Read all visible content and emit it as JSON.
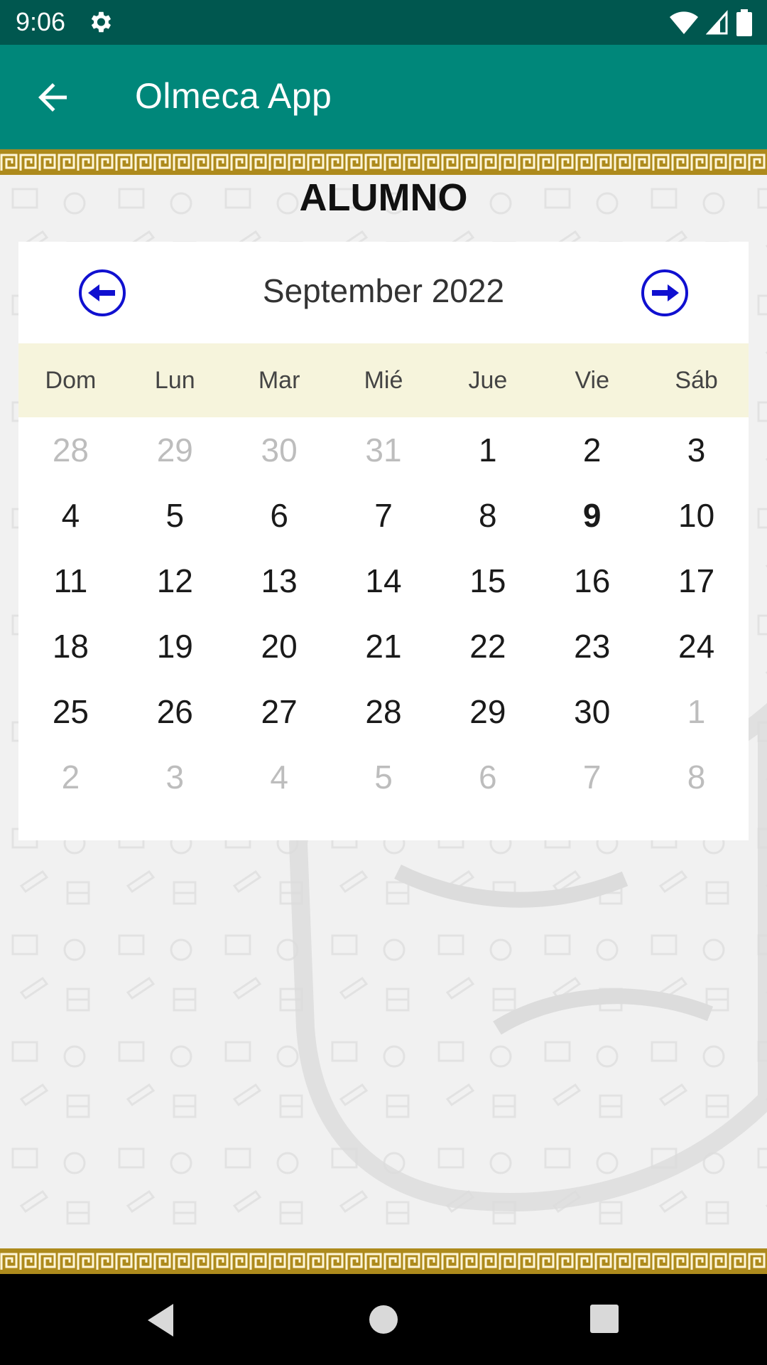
{
  "status_bar": {
    "time": "9:06"
  },
  "app_bar": {
    "title": "Olmeca App"
  },
  "page": {
    "title": "ALUMNO"
  },
  "calendar": {
    "month": "September 2022",
    "weekdays": [
      "Dom",
      "Lun",
      "Mar",
      "Mié",
      "Jue",
      "Vie",
      "Sáb"
    ],
    "days": [
      {
        "label": "28",
        "muted": true
      },
      {
        "label": "29",
        "muted": true
      },
      {
        "label": "30",
        "muted": true
      },
      {
        "label": "31",
        "muted": true
      },
      {
        "label": "1"
      },
      {
        "label": "2"
      },
      {
        "label": "3"
      },
      {
        "label": "4"
      },
      {
        "label": "5"
      },
      {
        "label": "6"
      },
      {
        "label": "7"
      },
      {
        "label": "8"
      },
      {
        "label": "9",
        "today": true
      },
      {
        "label": "10"
      },
      {
        "label": "11"
      },
      {
        "label": "12"
      },
      {
        "label": "13"
      },
      {
        "label": "14"
      },
      {
        "label": "15"
      },
      {
        "label": "16"
      },
      {
        "label": "17"
      },
      {
        "label": "18"
      },
      {
        "label": "19"
      },
      {
        "label": "20"
      },
      {
        "label": "21"
      },
      {
        "label": "22"
      },
      {
        "label": "23"
      },
      {
        "label": "24"
      },
      {
        "label": "25"
      },
      {
        "label": "26"
      },
      {
        "label": "27"
      },
      {
        "label": "28"
      },
      {
        "label": "29"
      },
      {
        "label": "30"
      },
      {
        "label": "1",
        "muted": true
      },
      {
        "label": "2",
        "muted": true
      },
      {
        "label": "3",
        "muted": true
      },
      {
        "label": "4",
        "muted": true
      },
      {
        "label": "5",
        "muted": true
      },
      {
        "label": "6",
        "muted": true
      },
      {
        "label": "7",
        "muted": true
      },
      {
        "label": "8",
        "muted": true
      }
    ]
  },
  "icons": {
    "back": "arrow-left-icon",
    "prev": "circle-arrow-left-icon",
    "next": "circle-arrow-right-icon"
  },
  "colors": {
    "status_bar": "#00574f",
    "app_bar": "#00877a",
    "border": "#ad8a1c",
    "weekday_band": "#f6f4dc",
    "nav_arrows": "#1010d0"
  }
}
